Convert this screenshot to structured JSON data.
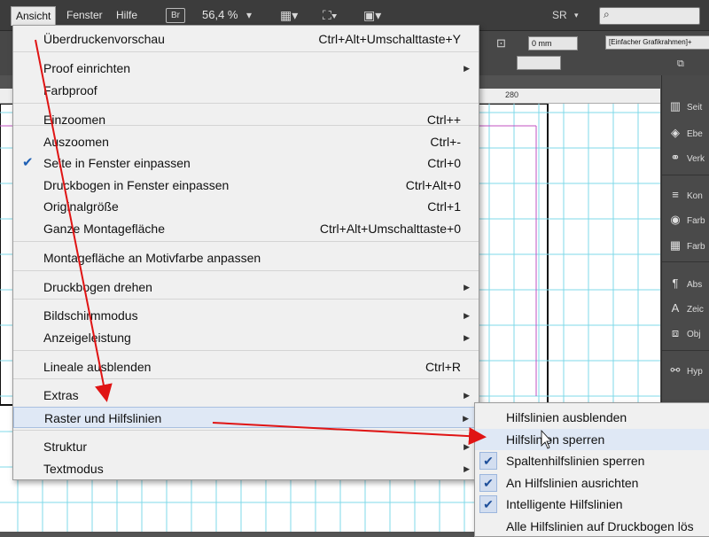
{
  "menubar": {
    "items": [
      "Ansicht",
      "Fenster",
      "Hilfe"
    ],
    "br_badge": "Br",
    "zoom": "56,4 %",
    "workspace": "SR"
  },
  "controlbar": {
    "stroke_value": "0 mm",
    "frame_style": "[Einfacher Grafikrahmen]+"
  },
  "ruler": {
    "label": "280"
  },
  "main_menu": {
    "items": [
      {
        "label": "Überdruckenvorschau",
        "shortcut": "Ctrl+Alt+Umschalttaste+Y"
      },
      {
        "label": "Proof einrichten",
        "submenu": true
      },
      {
        "label": "Farbproof"
      },
      {
        "label": "Einzoomen",
        "shortcut": "Ctrl++"
      },
      {
        "label": "Auszoomen",
        "shortcut": "Ctrl+-"
      },
      {
        "label": "Seite in Fenster einpassen",
        "shortcut": "Ctrl+0",
        "checked": true
      },
      {
        "label": "Druckbogen in Fenster einpassen",
        "shortcut": "Ctrl+Alt+0"
      },
      {
        "label": "Originalgröße",
        "shortcut": "Ctrl+1"
      },
      {
        "label": "Ganze Montagefläche",
        "shortcut": "Ctrl+Alt+Umschalttaste+0"
      },
      {
        "label": "Montagefläche an Motivfarbe anpassen"
      },
      {
        "label": "Druckbogen drehen",
        "submenu": true
      },
      {
        "label": "Bildschirmmodus",
        "submenu": true
      },
      {
        "label": "Anzeigeleistung",
        "submenu": true
      },
      {
        "label": "Lineale ausblenden",
        "shortcut": "Ctrl+R"
      },
      {
        "label": "Extras",
        "submenu": true
      },
      {
        "label": "Raster und Hilfslinien",
        "submenu": true,
        "highlighted": true
      },
      {
        "label": "Struktur",
        "submenu": true
      },
      {
        "label": "Textmodus",
        "submenu": true
      }
    ]
  },
  "sub_menu": {
    "items": [
      {
        "label": "Hilfslinien ausblenden"
      },
      {
        "label": "Hilfslinien sperren",
        "highlighted": true
      },
      {
        "label": "Spaltenhilfslinien sperren",
        "checked": true
      },
      {
        "label": "An Hilfslinien ausrichten",
        "checked": true
      },
      {
        "label": "Intelligente Hilfslinien",
        "checked": true
      },
      {
        "label": "Alle Hilfslinien auf Druckbogen lös"
      }
    ]
  },
  "right_panel": {
    "items": [
      "Seit",
      "Ebe",
      "Verk",
      "Kon",
      "Farb",
      "Farb",
      "Abs",
      "Zeic",
      "Obj",
      "Hyp"
    ]
  },
  "colors": {
    "guide_cyan": "#7fd8e8",
    "margin_magenta": "#c050c0",
    "check_blue": "#1e5fb4",
    "arrow_red": "#e01414"
  }
}
